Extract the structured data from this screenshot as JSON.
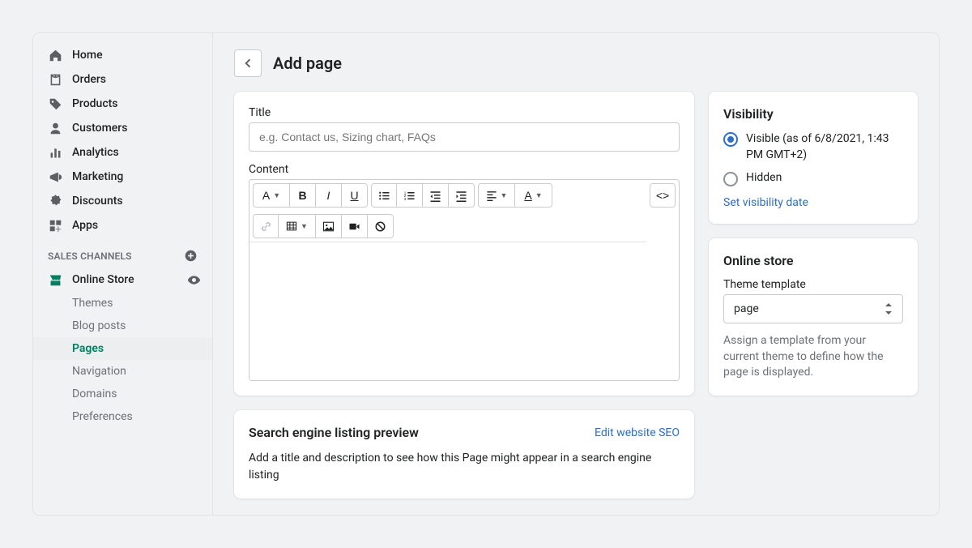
{
  "sidebar": {
    "items": [
      {
        "label": "Home"
      },
      {
        "label": "Orders"
      },
      {
        "label": "Products"
      },
      {
        "label": "Customers"
      },
      {
        "label": "Analytics"
      },
      {
        "label": "Marketing"
      },
      {
        "label": "Discounts"
      },
      {
        "label": "Apps"
      }
    ],
    "section_label": "SALES CHANNELS",
    "online_store_label": "Online Store",
    "subitems": [
      {
        "label": "Themes"
      },
      {
        "label": "Blog posts"
      },
      {
        "label": "Pages"
      },
      {
        "label": "Navigation"
      },
      {
        "label": "Domains"
      },
      {
        "label": "Preferences"
      }
    ]
  },
  "page_title": "Add page",
  "title_field": {
    "label": "Title",
    "placeholder": "e.g. Contact us, Sizing chart, FAQs"
  },
  "content_field": {
    "label": "Content"
  },
  "seo": {
    "heading": "Search engine listing preview",
    "link": "Edit website SEO",
    "body": "Add a title and description to see how this Page might appear in a search engine listing"
  },
  "visibility": {
    "heading": "Visibility",
    "visible_label": "Visible (as of 6/8/2021, 1:43 PM GMT+2)",
    "hidden_label": "Hidden",
    "date_link": "Set visibility date"
  },
  "online_store_card": {
    "heading": "Online store",
    "template_label": "Theme template",
    "template_value": "page",
    "help": "Assign a template from your current theme to define how the page is displayed."
  },
  "toolbar": {
    "format_letter": "A",
    "bold": "B",
    "italic": "I",
    "underline": "U",
    "textcolor": "A",
    "code": "<>"
  }
}
